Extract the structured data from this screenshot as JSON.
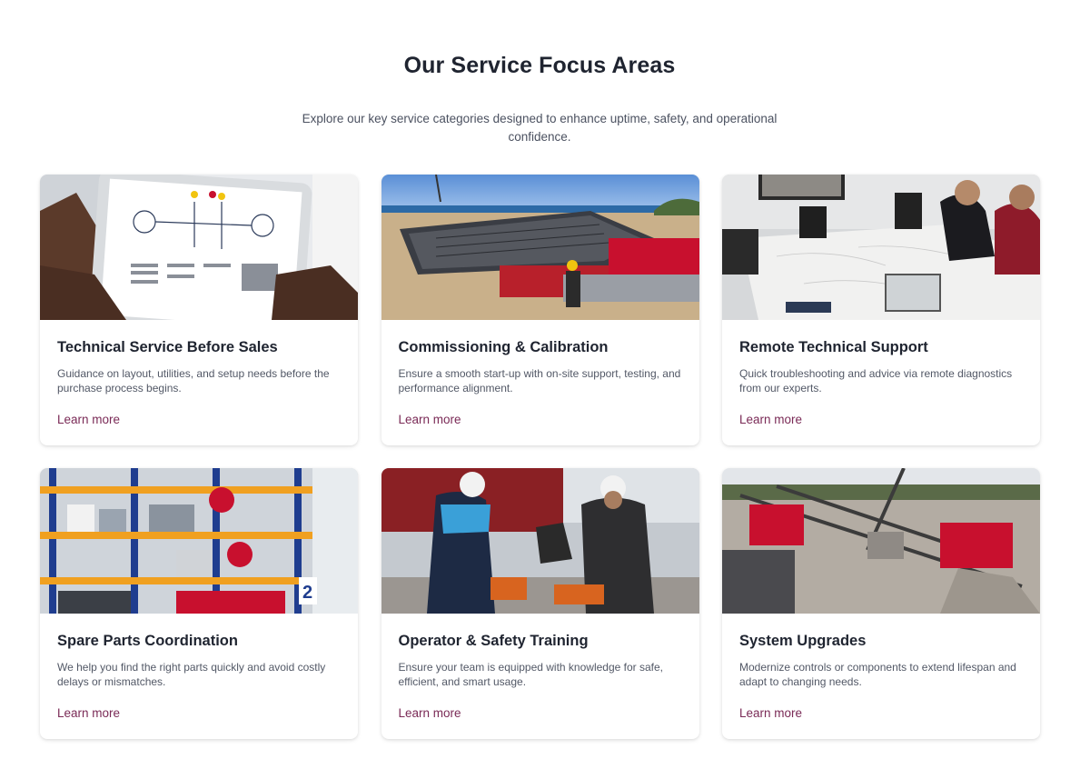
{
  "section": {
    "title": "Our Service Focus Areas",
    "subtitle": "Explore our key service categories designed to enhance uptime, safety, and operational confidence."
  },
  "cards": [
    {
      "title": "Technical Service Before Sales",
      "description": "Guidance on layout, utilities, and setup needs before the purchase process begins.",
      "link": "Learn more",
      "image": "tablet-layout-plan-image"
    },
    {
      "title": "Commissioning & Calibration",
      "description": "Ensure a smooth start-up with on-site support, testing, and performance alignment.",
      "link": "Learn more",
      "image": "crusher-commissioning-image"
    },
    {
      "title": "Remote Technical Support",
      "description": "Quick troubleshooting and advice via remote diagnostics from our experts.",
      "link": "Learn more",
      "image": "meeting-room-support-image"
    },
    {
      "title": "Spare Parts Coordination",
      "description": "We help you find the right parts quickly and avoid costly delays or mismatches.",
      "link": "Learn more",
      "image": "warehouse-shelves-image"
    },
    {
      "title": "Operator & Safety Training",
      "description": "Ensure your team is equipped with knowledge for safe, efficient, and smart usage.",
      "link": "Learn more",
      "image": "operators-remote-control-image"
    },
    {
      "title": "System Upgrades",
      "description": "Modernize controls or components to extend lifespan and adapt to changing needs.",
      "link": "Learn more",
      "image": "crushing-plant-conveyors-image"
    }
  ],
  "colors": {
    "link": "#7a2a56",
    "title": "#1f2430",
    "accent_red": "#c8102e"
  }
}
